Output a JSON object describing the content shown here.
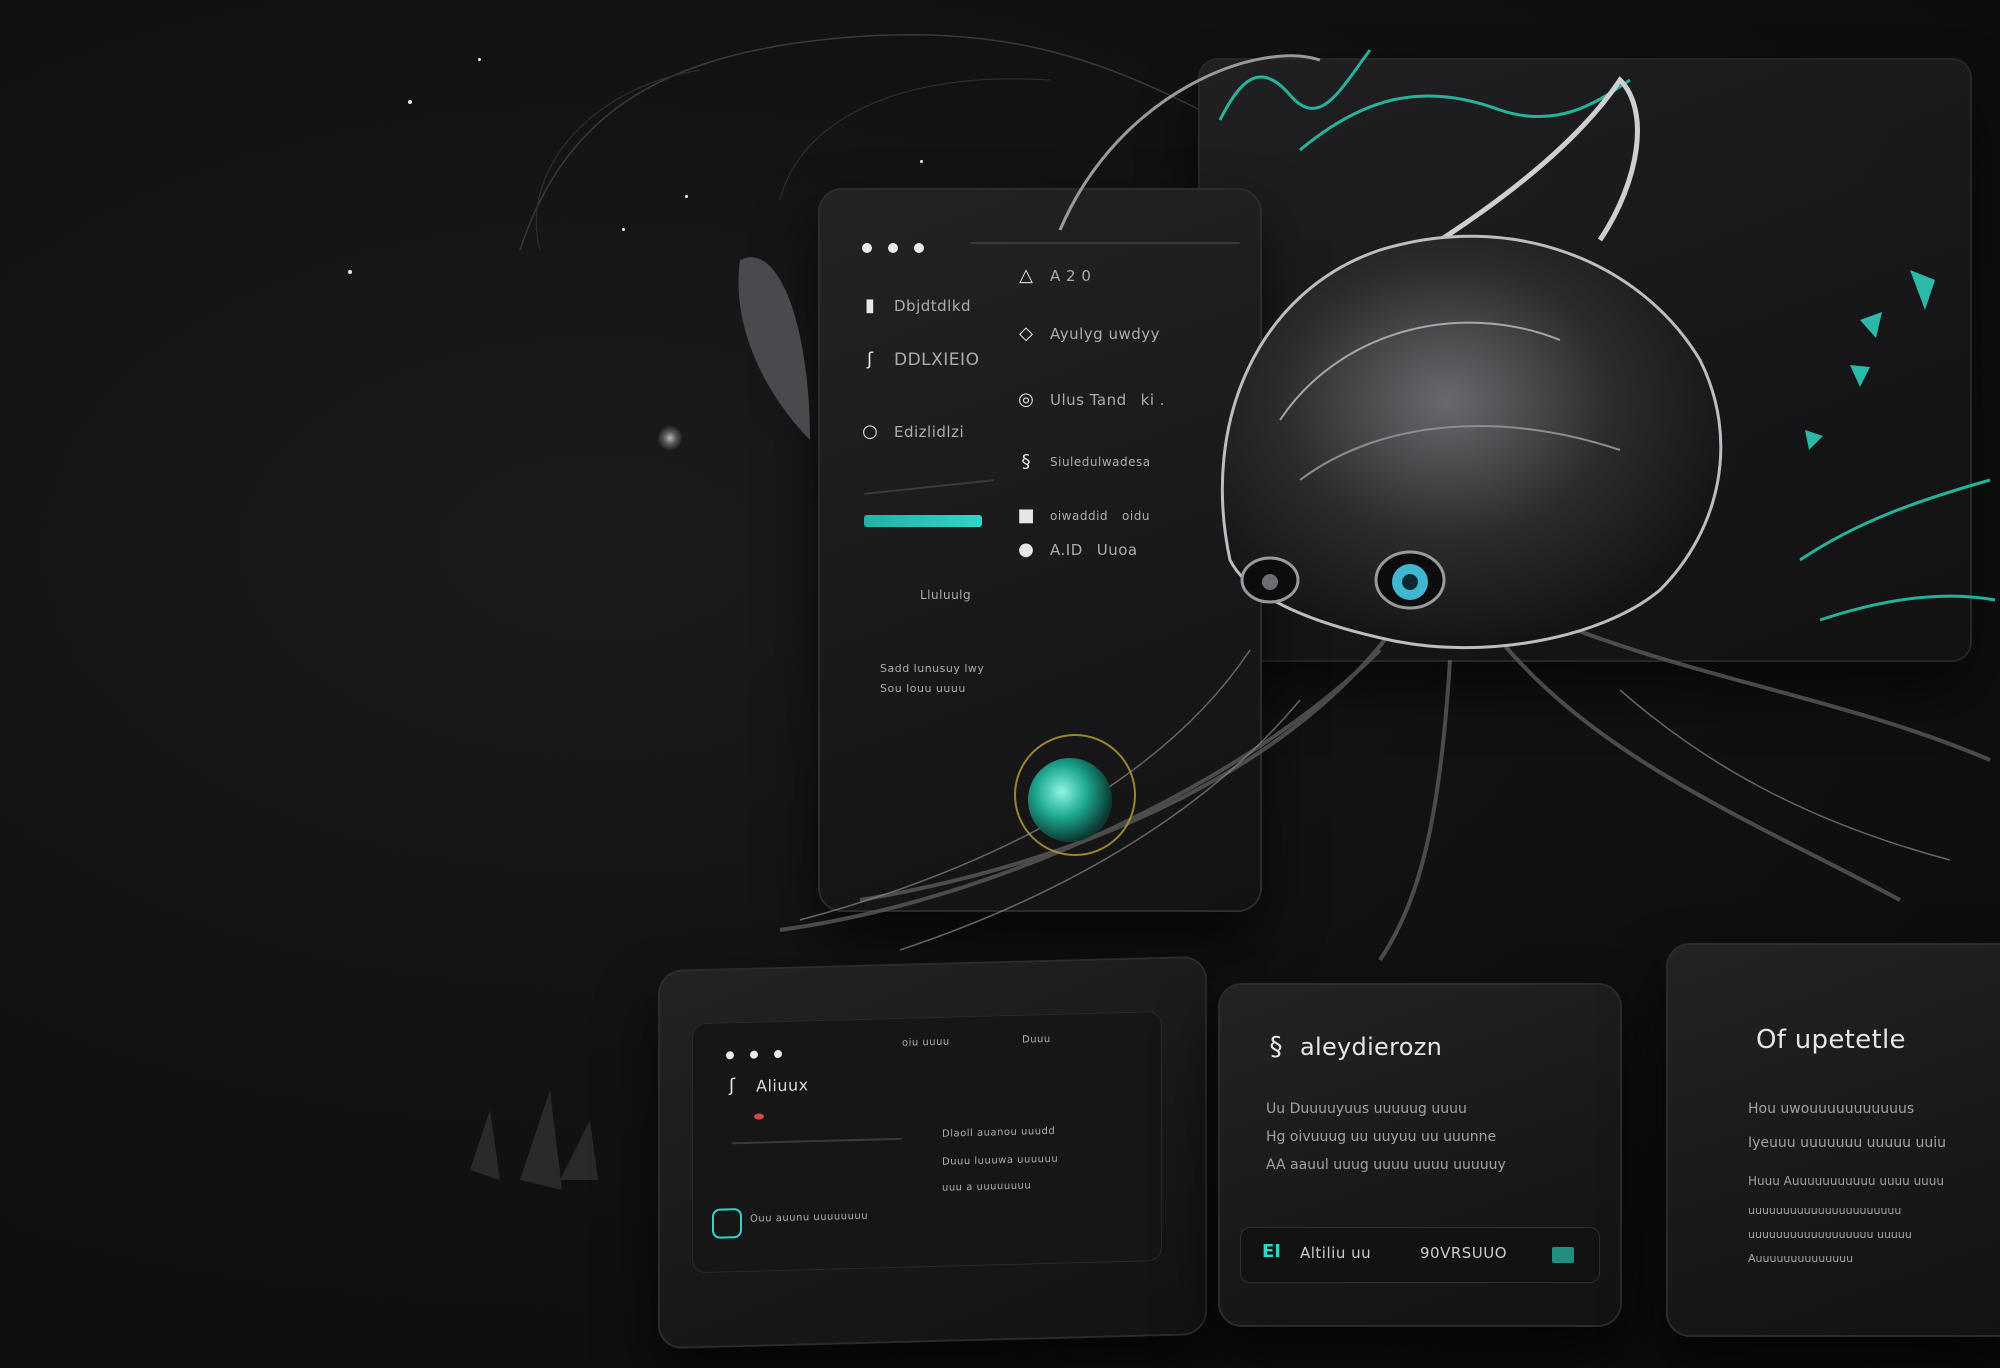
{
  "main_panel": {
    "sidebar": [
      {
        "label": "Dbjdtdlkd"
      },
      {
        "label": "DDLXIEIO"
      },
      {
        "label": "Edizlidlzi"
      }
    ],
    "list": [
      {
        "label": "A 2 0",
        "meta": ""
      },
      {
        "label": "Ayulyg uwdyy",
        "meta": ""
      },
      {
        "label": "Ulus Tand",
        "meta": "ki ."
      },
      {
        "label": "Siuledulwadesa",
        "meta": ""
      },
      {
        "label": "oiwaddid",
        "meta": "oidu"
      },
      {
        "label": "A.ID",
        "meta": "Uuoa"
      }
    ],
    "footer_label": "Lluluulg",
    "footer_lines": [
      "Sadd lunusuy lwy",
      "Sou louu uuuu"
    ],
    "progress": 1.0
  },
  "card_left": {
    "title": "Aliuux",
    "header_cols": [
      "",
      "oiu uuuu",
      "Duuu"
    ],
    "rows": [
      "Dlaoll auanou uuudd",
      "Duuu luuuwa uuuuuu",
      "uuu a uuuuuuuu"
    ],
    "footer": "Ouu auunu uuuuuuuu"
  },
  "card_center": {
    "title": "aleydierozn",
    "lines": [
      "Uu Duuuuyuus uuuuug uuuu",
      "Hg oivuuug uu uuyuu uu uuunne",
      "AA aauul uuug uuuu uuuu uuuuuy"
    ],
    "button_icon_label": "EI",
    "button_label": "Altiliu uu",
    "button_secondary": "90VRSUUO"
  },
  "card_right": {
    "title": "Of upetetle",
    "lines": [
      "Hou uwouuuuuuuuuuus",
      "Iyeuuu uuuuuuu uuuuu uuiu",
      "Huuu Auuuuuuuuuuu uuuu uuuu",
      "uuuuuuuuuuuuuuuuuuuuuu",
      "uuuuuuuuuuuuuuuuuu uuuuu",
      "Auuuuuuuuuuuuuu"
    ]
  },
  "colors": {
    "accent_teal": "#2fd6c4",
    "background": "#111112",
    "panel": "#1c1c1e",
    "creature_eye": "#3fb7d0"
  }
}
